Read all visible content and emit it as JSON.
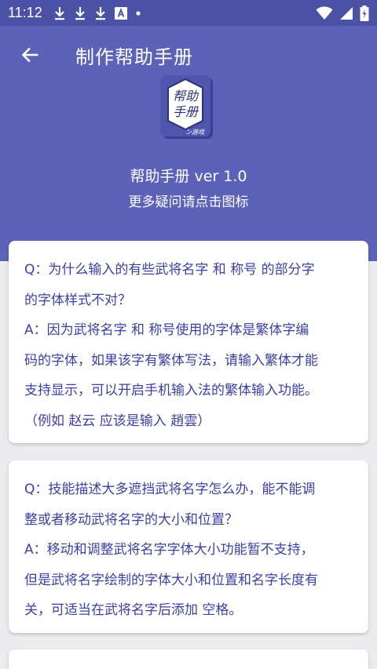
{
  "status_bar": {
    "time": "11:12",
    "left_icons": [
      "download-icon",
      "download-icon",
      "download-icon",
      "a-box-icon",
      "dot-icon"
    ],
    "right_icons": [
      "wifi-icon",
      "signal-icon",
      "battery-icon"
    ]
  },
  "app_bar": {
    "title": "制作帮助手册",
    "back_icon": "arrow-left-icon"
  },
  "header": {
    "icon_text_line1": "帮助",
    "icon_text_line2": "手册",
    "icon_signature": "ン游戏",
    "version": "帮助手册 ver 1.0",
    "hint": "更多疑问请点击图标"
  },
  "faq": [
    {
      "lines": [
        "Q：为什么输入的有些武将名字 和 称号 的部分字",
        "的字体样式不对？",
        "A：因为武将名字 和 称号使用的字体是繁体字编",
        "码的字体，如果该字有繁体写法，请输入繁体才能",
        "支持显示，可以开启手机输入法的繁体输入功能。",
        "（例如 赵云 应该是输入 趙雲）"
      ]
    },
    {
      "lines": [
        "Q：技能描述大多遮挡武将名字怎么办，能不能调",
        "整或者移动武将名字的大小和位置？",
        "A：移动和调整武将名字字体大小功能暂不支持，",
        "但是武将名字绘制的字体大小和位置和名字长度有",
        "关，可适当在武将名字后添加 空格。"
      ]
    }
  ],
  "colors": {
    "header_bg": "#5b62b8",
    "status_bar_bg": "#4b52a6",
    "page_bg": "#ececee",
    "card_text": "#3b40a3"
  }
}
